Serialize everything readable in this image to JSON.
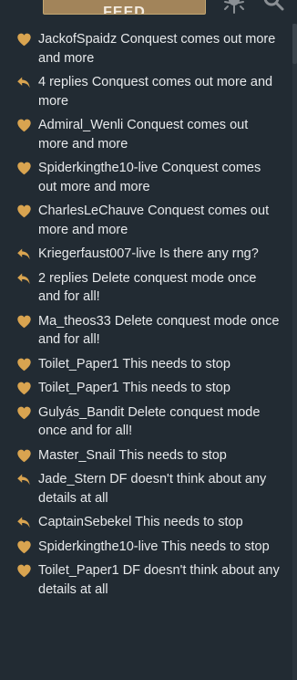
{
  "header": {
    "button_label": "FEED",
    "sun_icon": "sun-icon",
    "search_icon": "search-icon"
  },
  "colors": {
    "background": "#222b33",
    "accent": "#d9a450",
    "text": "#e7e9eb"
  },
  "notifications": [
    {
      "icon": "heart-icon",
      "text": "JackofSpaidz Conquest comes out more and more"
    },
    {
      "icon": "reply-icon",
      "text": "4 replies Conquest comes out more and more"
    },
    {
      "icon": "heart-icon",
      "text": "Admiral_Wenli Conquest comes out more and more"
    },
    {
      "icon": "heart-icon",
      "text": "Spiderkingthe10-live Conquest comes out more and more"
    },
    {
      "icon": "heart-icon",
      "text": "CharlesLeChauve Conquest comes out more and more"
    },
    {
      "icon": "reply-icon",
      "text": "Kriegerfaust007-live Is there any rng?"
    },
    {
      "icon": "reply-icon",
      "text": "2 replies Delete conquest mode once and for all!"
    },
    {
      "icon": "heart-icon",
      "text": "Ma_theos33 Delete conquest mode once and for all!"
    },
    {
      "icon": "heart-icon",
      "text": "Toilet_Paper1 This needs to stop"
    },
    {
      "icon": "heart-icon",
      "text": "Toilet_Paper1 This needs to stop"
    },
    {
      "icon": "heart-icon",
      "text": "Gulyás_Bandit Delete conquest mode once and for all!"
    },
    {
      "icon": "heart-icon",
      "text": "Master_Snail This needs to stop"
    },
    {
      "icon": "reply-icon",
      "text": "Jade_Stern DF doesn't think about any details at all"
    },
    {
      "icon": "reply-icon",
      "text": "CaptainSebekel This needs to stop"
    },
    {
      "icon": "heart-icon",
      "text": "Spiderkingthe10-live This needs to stop"
    },
    {
      "icon": "heart-icon",
      "text": "Toilet_Paper1 DF doesn't think about any details at all"
    }
  ]
}
